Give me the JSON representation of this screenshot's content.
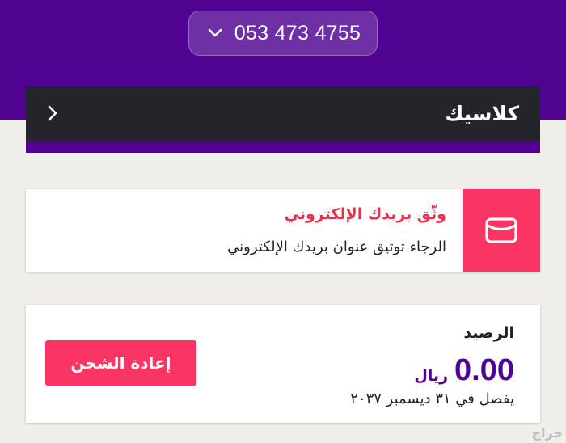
{
  "header": {
    "phone_number": "053 473 4755",
    "dropdown_icon": "chevron-down-icon"
  },
  "title_bar": {
    "title": "كلاسيك",
    "back_icon": "chevron-right-icon"
  },
  "email_notice": {
    "icon": "envelope-icon",
    "heading": "وثّق بريدك الإلكتروني",
    "message": "الرجاء توثيق عنوان بريدك الإلكتروني"
  },
  "balance": {
    "label": "الرصيد",
    "amount": "0.00",
    "currency": "ريال",
    "expiry": "يفصل في ٣١ ديسمبر ٢٠٣٧",
    "recharge_button": "إعادة الشحن"
  },
  "watermark": {
    "text": "حراج"
  },
  "colors": {
    "brand_purple": "#4f0390",
    "accent_pink": "#fb3563",
    "heading_red": "#e8304e",
    "title_bar_dark": "#23252b",
    "page_background": "#efeeeb"
  }
}
